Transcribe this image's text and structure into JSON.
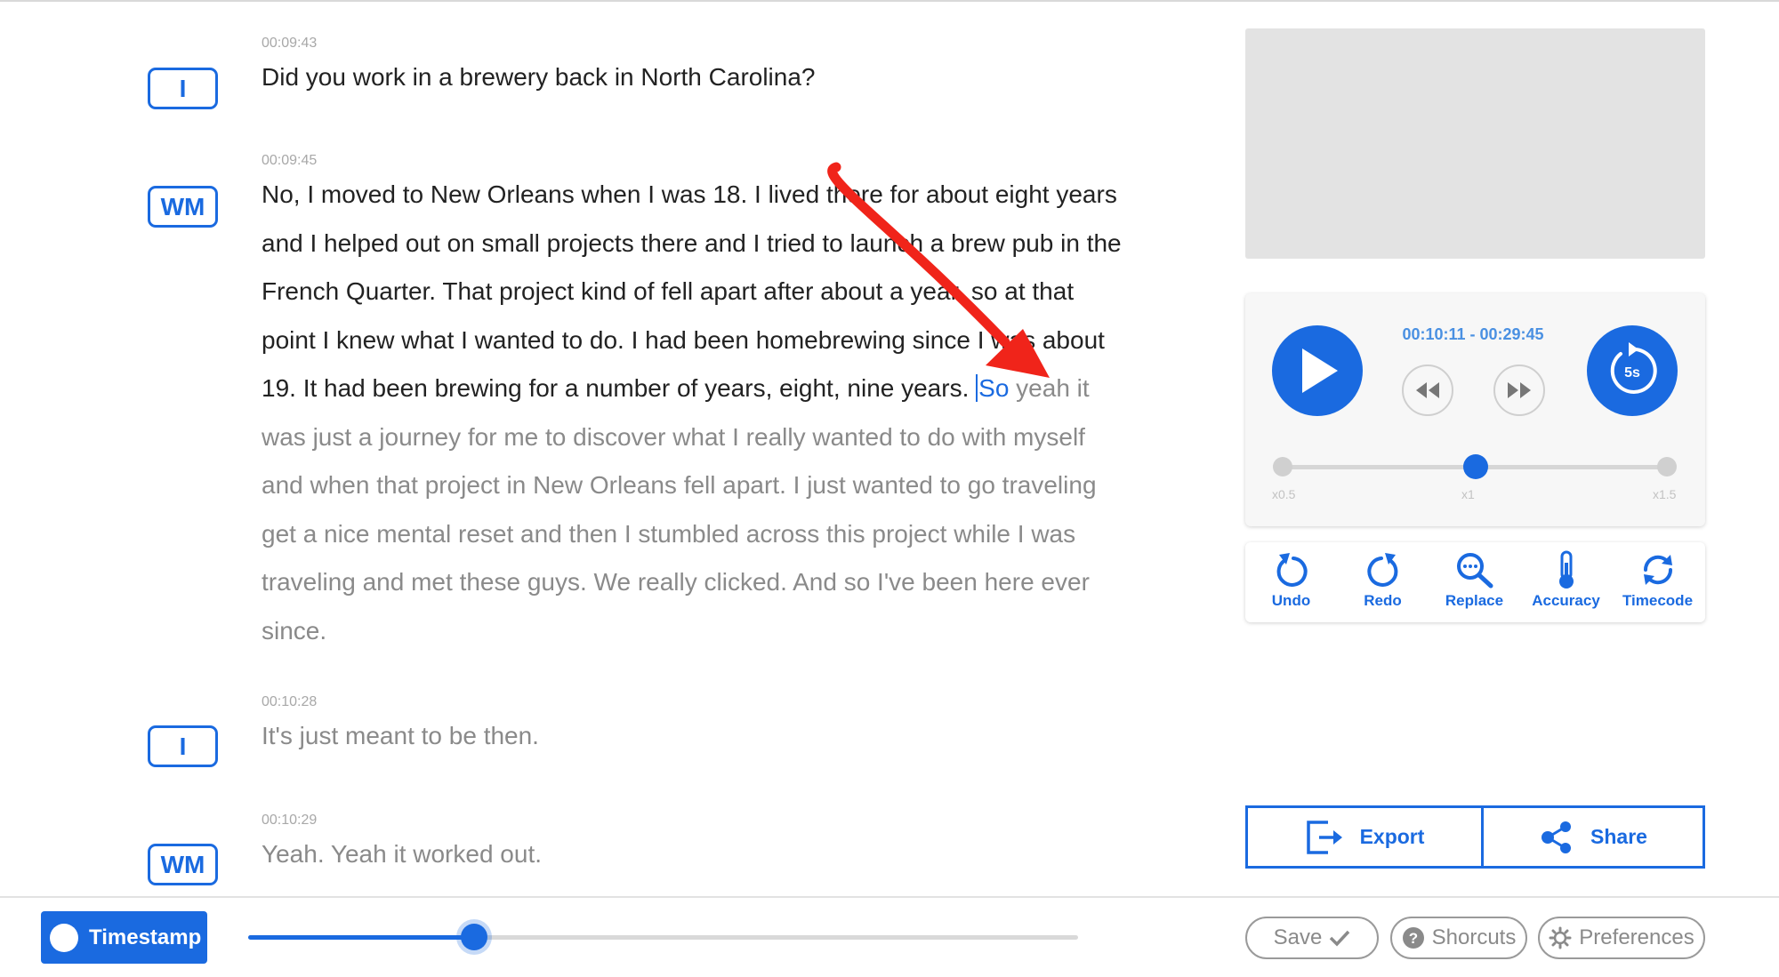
{
  "transcript": {
    "segments": [
      {
        "speaker": "I",
        "timestamp": "00:09:43",
        "text": "Did you work in a brewery back in North Carolina?"
      },
      {
        "speaker": "WM",
        "timestamp": "00:09:45",
        "text_spoken": "No, I moved to New Orleans when I was 18. I lived there for about eight years and I helped out on small projects there and I tried to launch a brew pub in the French Quarter. That project kind of fell apart after about a year, so at that point I knew what I wanted to do. I had been homebrewing since I was about 19. It had been brewing for a number of years, eight, nine years. ",
        "text_cursor_word": "So",
        "text_upcoming": " yeah it was just a journey for me to discover what I really wanted to do with myself and when that project in New Orleans fell apart. I just wanted to go traveling get a nice mental reset and then I stumbled across this project while I was traveling and met these guys. We really clicked. And so I've been here ever since."
      },
      {
        "speaker": "I",
        "timestamp": "00:10:28",
        "text": "It's just meant to be then."
      },
      {
        "speaker": "WM",
        "timestamp": "00:10:29",
        "text": " Yeah. Yeah it worked out."
      }
    ]
  },
  "player": {
    "time_range": "00:10:11 - 00:29:45",
    "replay_label": "5s",
    "speeds": [
      "x0.5",
      "x1",
      "x1.5"
    ],
    "current_speed_index": 1
  },
  "tools": [
    {
      "label": "Undo",
      "icon": "undo-icon"
    },
    {
      "label": "Redo",
      "icon": "redo-icon"
    },
    {
      "label": "Replace",
      "icon": "search-replace-icon"
    },
    {
      "label": "Accuracy",
      "icon": "thermometer-icon"
    },
    {
      "label": "Timecode",
      "icon": "timecode-sync-icon"
    }
  ],
  "actions": {
    "export_label": "Export",
    "share_label": "Share"
  },
  "bottom": {
    "timestamp_label": "Timestamp",
    "progress_fraction": 0.272,
    "save_label": "Save",
    "shortcuts_label": "Shorcuts",
    "preferences_label": "Preferences"
  },
  "colors": {
    "accent": "#1a6ae0",
    "annotation_arrow": "#f0241a",
    "muted_text": "#8a8a8a"
  }
}
